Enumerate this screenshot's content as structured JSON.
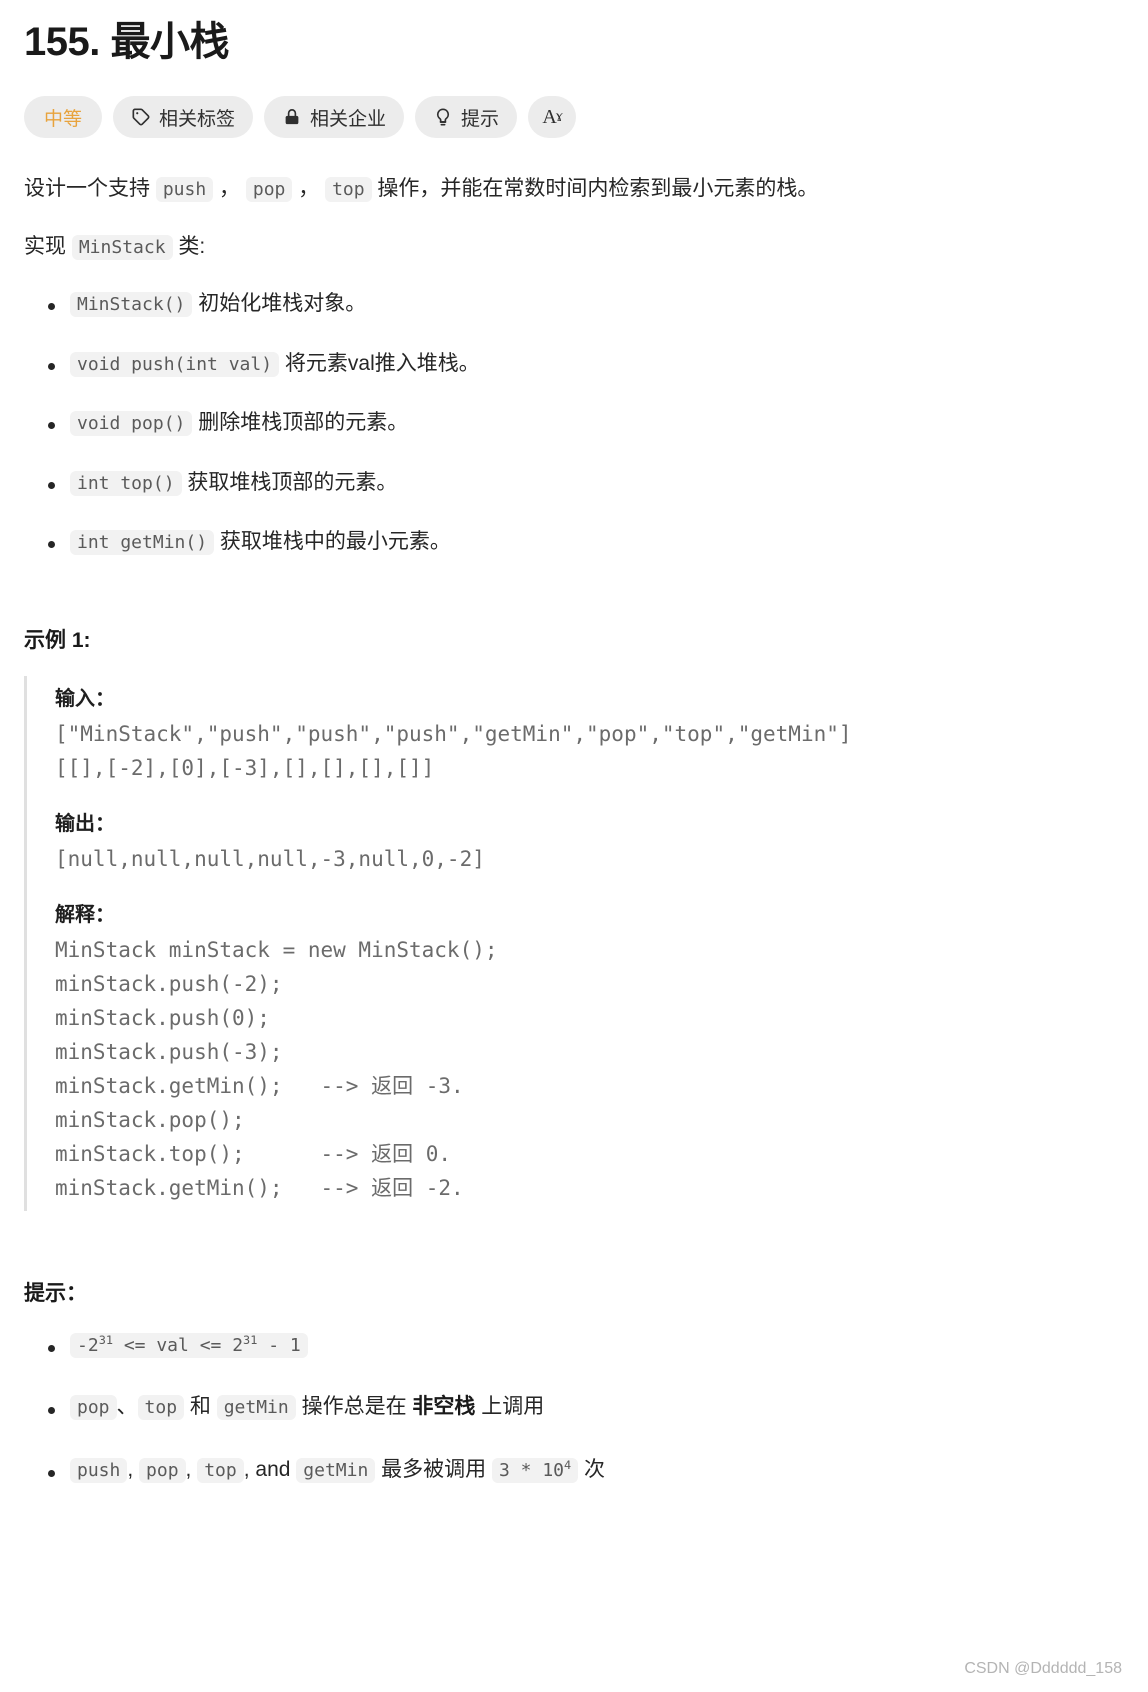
{
  "problem": {
    "title": "155. 最小栈",
    "badges": [
      {
        "label": "中等",
        "icon": "none",
        "kind": "difficulty"
      },
      {
        "label": "相关标签",
        "icon": "tag-icon",
        "kind": "normal"
      },
      {
        "label": "相关企业",
        "icon": "lock-icon",
        "kind": "normal"
      },
      {
        "label": "提示",
        "icon": "lightbulb-icon",
        "kind": "normal"
      },
      {
        "label": "",
        "icon": "font-size-icon",
        "kind": "square"
      }
    ],
    "intro_prefix": "设计一个支持 ",
    "intro_code_push": "push",
    "intro_sep1": " ， ",
    "intro_code_pop": "pop",
    "intro_sep2": " ， ",
    "intro_code_top": "top",
    "intro_suffix": " 操作，并能在常数时间内检索到最小元素的栈。",
    "implement_prefix": "实现 ",
    "implement_code": "MinStack",
    "implement_suffix": " 类:",
    "methods": [
      {
        "code": "MinStack()",
        "desc": "初始化堆栈对象。"
      },
      {
        "code": "void push(int val)",
        "desc": "将元素val推入堆栈。"
      },
      {
        "code": "void pop()",
        "desc": "删除堆栈顶部的元素。"
      },
      {
        "code": "int top()",
        "desc": "获取堆栈顶部的元素。"
      },
      {
        "code": "int getMin()",
        "desc": "获取堆栈中的最小元素。"
      }
    ]
  },
  "example": {
    "heading": "示例 1:",
    "input_label": "输入：",
    "input_text": "[\"MinStack\",\"push\",\"push\",\"push\",\"getMin\",\"pop\",\"top\",\"getMin\"]\n[[],[-2],[0],[-3],[],[],[],[]]",
    "output_label": "输出：",
    "output_text": "[null,null,null,null,-3,null,0,-2]",
    "explain_label": "解释：",
    "explain_text": "MinStack minStack = new MinStack();\nminStack.push(-2);\nminStack.push(0);\nminStack.push(-3);\nminStack.getMin();   --> 返回 -3.\nminStack.pop();\nminStack.top();      --> 返回 0.\nminStack.getMin();   --> 返回 -2."
  },
  "hints": {
    "heading": "提示：",
    "item1": {
      "code_pre": "-2",
      "code_sup1": "31",
      "code_mid": " <= val <= 2",
      "code_sup2": "31",
      "code_post": " - 1"
    },
    "item2": {
      "code1": "pop",
      "sep1": "、",
      "code2": "top",
      "sep2": " 和 ",
      "code3": "getMin",
      "text1": " 操作总是在 ",
      "bold": "非空栈",
      "text2": " 上调用"
    },
    "item3": {
      "code1": "push",
      "sep1": ", ",
      "code2": "pop",
      "sep2": ", ",
      "code3": "top",
      "sep3": ", and ",
      "code4": "getMin",
      "text1": " 最多被调用 ",
      "code5": "3 * 10",
      "code5_sup": "4",
      "text2": " 次"
    }
  },
  "footer": {
    "watermark": "CSDN @Dddddd_158"
  }
}
